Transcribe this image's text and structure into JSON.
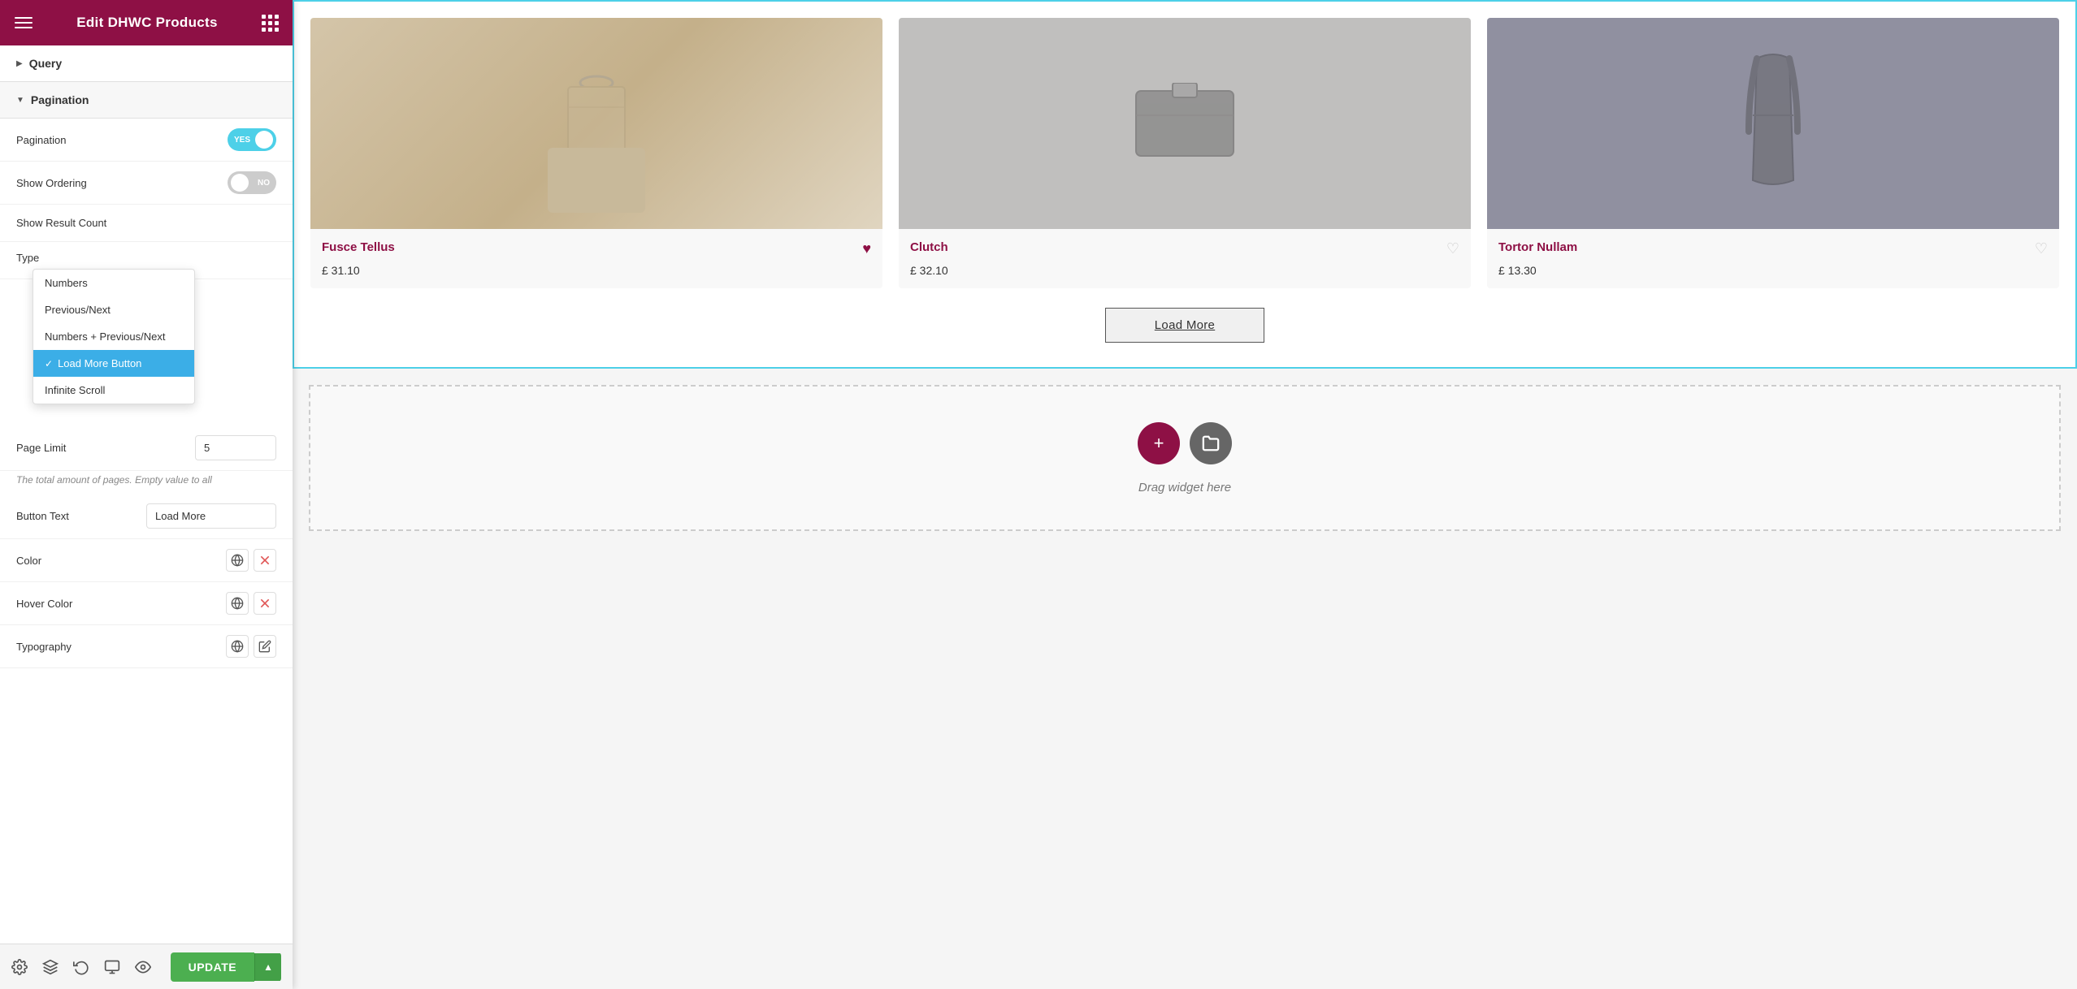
{
  "header": {
    "title": "Edit DHWC Products",
    "hamburger_label": "menu",
    "grid_label": "apps"
  },
  "sidebar": {
    "query_label": "Query",
    "pagination_label": "Pagination",
    "fields": {
      "pagination_label": "Pagination",
      "pagination_value": "YES",
      "show_ordering_label": "Show Ordering",
      "show_ordering_value": "NO",
      "show_result_count_label": "Show Result Count",
      "type_label": "Type",
      "page_limit_label": "Page Limit",
      "page_limit_value": "5",
      "page_limit_helper": "The total amount of pages. Empty value to all",
      "button_text_label": "Button Text",
      "button_text_value": "Load More",
      "color_label": "Color",
      "hover_color_label": "Hover Color",
      "typography_label": "Typography"
    },
    "dropdown": {
      "items": [
        {
          "id": "numbers",
          "label": "Numbers",
          "selected": false
        },
        {
          "id": "previous_next",
          "label": "Previous/Next",
          "selected": false
        },
        {
          "id": "numbers_previous_next",
          "label": "Numbers + Previous/Next",
          "selected": false
        },
        {
          "id": "load_more_button",
          "label": "Load More Button",
          "selected": true
        },
        {
          "id": "infinite_scroll",
          "label": "Infinite Scroll",
          "selected": false
        }
      ]
    }
  },
  "toolbar": {
    "update_label": "UPDATE"
  },
  "products": {
    "items": [
      {
        "name": "Fusce Tellus",
        "price": "£ 31.10",
        "heart_filled": true
      },
      {
        "name": "Clutch",
        "price": "£ 32.10",
        "heart_filled": false
      },
      {
        "name": "Tortor Nullam",
        "price": "£ 13.30",
        "heart_filled": false
      }
    ],
    "load_more_label": "Load More"
  },
  "drag_widget": {
    "text": "Drag widget here"
  }
}
